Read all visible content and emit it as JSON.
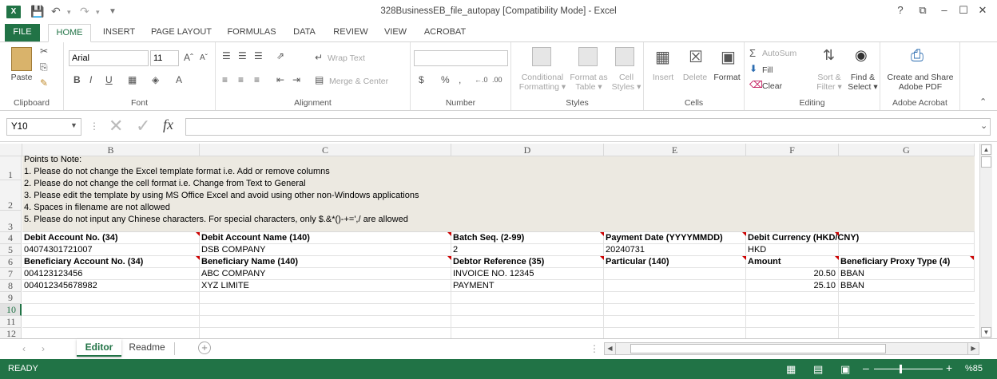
{
  "window": {
    "title": "328BusinessEB_file_autopay  [Compatibility Mode] - Excel",
    "app_icon": "X",
    "controls": [
      "?",
      "⧉",
      "–",
      "☐",
      "✕"
    ]
  },
  "tabs": [
    "FILE",
    "HOME",
    "INSERT",
    "PAGE LAYOUT",
    "FORMULAS",
    "DATA",
    "REVIEW",
    "VIEW",
    "ACROBAT"
  ],
  "ribbon": {
    "clipboard": {
      "paste": "Paste",
      "group": "Clipboard"
    },
    "font": {
      "name": "Arial",
      "size": "11",
      "group": "Font",
      "bold": "B",
      "italic": "I",
      "underline": "U"
    },
    "alignment": {
      "wrap": "Wrap Text",
      "merge": "Merge & Center",
      "group": "Alignment"
    },
    "number": {
      "format": "",
      "currency": "$",
      "percent": "%",
      "comma": ",",
      "group": "Number"
    },
    "styles": {
      "conditional": "Conditional",
      "conditional2": "Formatting",
      "format_as": "Format as",
      "format_as2": "Table",
      "cell": "Cell",
      "cell2": "Styles",
      "group": "Styles"
    },
    "cells": {
      "insert": "Insert",
      "delete": "Delete",
      "format": "Format",
      "group": "Cells"
    },
    "editing": {
      "autosum": "AutoSum",
      "fill": "Fill",
      "clear": "Clear",
      "sort": "Sort &",
      "sort2": "Filter",
      "find": "Find &",
      "find2": "Select",
      "group": "Editing"
    },
    "acrobat": {
      "create": "Create and Share",
      "create2": "Adobe PDF",
      "group": "Adobe Acrobat"
    }
  },
  "formula": {
    "name_box": "Y10",
    "fx": "fx",
    "value": ""
  },
  "columns": [
    "B",
    "C",
    "D",
    "E",
    "F",
    "G"
  ],
  "rows": [
    "1",
    "2",
    "3",
    "4",
    "5",
    "6",
    "7",
    "8",
    "9",
    "10",
    "11",
    "12"
  ],
  "notes": {
    "title": "Points to Note:",
    "items": [
      "1. Please do not change the Excel template format i.e. Add or remove columns",
      "2. Please do not change the cell format i.e. Change from Text to General",
      "3. Please edit the template by using MS Office Excel and avoid using other non-Windows applications",
      "4. Spaces in filename are not allowed",
      "5. Please do not input any Chinese characters. For special characters, only $.&*()-+=',/ are allowed"
    ]
  },
  "cells": {
    "r4": [
      "Debit Account No. (34)",
      "Debit Account Name (140)",
      "Batch Seq. (2-99)",
      "Payment Date (YYYYMMDD)",
      "Debit Currency (HKD/CNY)",
      ""
    ],
    "r5": [
      "04074301721007",
      "DSB COMPANY",
      "2",
      "20240731",
      "HKD",
      ""
    ],
    "r6": [
      "Beneficiary Account No. (34)",
      "Beneficiary Name (140)",
      "Debtor Reference (35)",
      "Particular (140)",
      "Amount",
      "Beneficiary Proxy Type (4)"
    ],
    "r7": [
      "004123123456",
      "ABC COMPANY",
      "INVOICE NO. 12345",
      "",
      "20.50",
      "BBAN"
    ],
    "r8": [
      "004012345678982",
      "XYZ LIMITE",
      "PAYMENT",
      "",
      "25.10",
      "BBAN"
    ]
  },
  "sheets": {
    "active": "Editor",
    "other": "Readme",
    "add": "+"
  },
  "status": {
    "mode": "READY",
    "zoom": "%85"
  }
}
